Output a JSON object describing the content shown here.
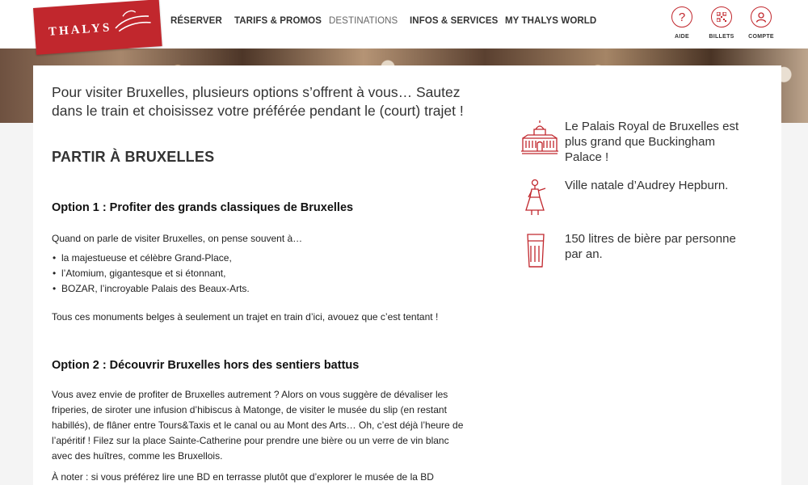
{
  "brand": {
    "logo_text": "THALYS"
  },
  "nav": {
    "items": [
      {
        "label": "RÉSERVER"
      },
      {
        "label": "TARIFS & PROMOS"
      },
      {
        "label": "DESTINATIONS"
      },
      {
        "label": "INFOS & SERVICES"
      },
      {
        "label": "MY THALYS WORLD"
      }
    ]
  },
  "utility": {
    "aide": {
      "label": "AIDE",
      "icon": "question-icon"
    },
    "billets": {
      "label": "BILLETS",
      "icon": "qr-code-icon"
    },
    "compte": {
      "label": "COMPTE",
      "icon": "user-icon"
    }
  },
  "colors": {
    "brand_red": "#c1272d"
  },
  "main": {
    "intro": "Pour visiter Bruxelles, plusieurs options s’offrent à vous… Sautez dans le train et choisissez votre préférée pendant le (court) trajet !",
    "section_title": "PARTIR À BRUXELLES",
    "option1": {
      "title": "Option 1 : Profiter des grands classiques de Bruxelles",
      "lead": "Quand on parle de visiter Bruxelles, on pense souvent à…",
      "bullets": [
        "la majestueuse et célèbre Grand-Place,",
        "l’Atomium, gigantesque et si étonnant,",
        "BOZAR, l’incroyable Palais des Beaux-Arts."
      ],
      "closing": "Tous ces monuments belges à seulement un trajet en train d’ici, avouez que c’est tentant !"
    },
    "option2": {
      "title": "Option 2 : Découvrir Bruxelles hors des sentiers battus",
      "body": "Vous avez envie de profiter de Bruxelles autrement ? Alors on vous suggère de dévaliser les friperies, de siroter une infusion d’hibiscus à Matonge, de visiter le musée du slip (en restant habillés), de flâner entre Tours&Taxis et le canal ou au Mont des Arts… Oh, c’est déjà l’heure de l’apéritif ! Filez sur la place Sainte-Catherine pour prendre une bière ou un verre de vin blanc avec des huîtres, comme les Bruxellois.",
      "note": "À noter : si vous préférez lire une BD en terrasse plutôt que d’explorer le musée de la BD (même"
    }
  },
  "facts": [
    {
      "icon": "palace-icon",
      "text": "Le Palais Royal de Bruxelles est plus grand que Buckingham Palace !"
    },
    {
      "icon": "woman-icon",
      "text": "Ville natale d’Audrey Hepburn."
    },
    {
      "icon": "beer-glass-icon",
      "text": "150 litres de bière par personne par an."
    }
  ]
}
